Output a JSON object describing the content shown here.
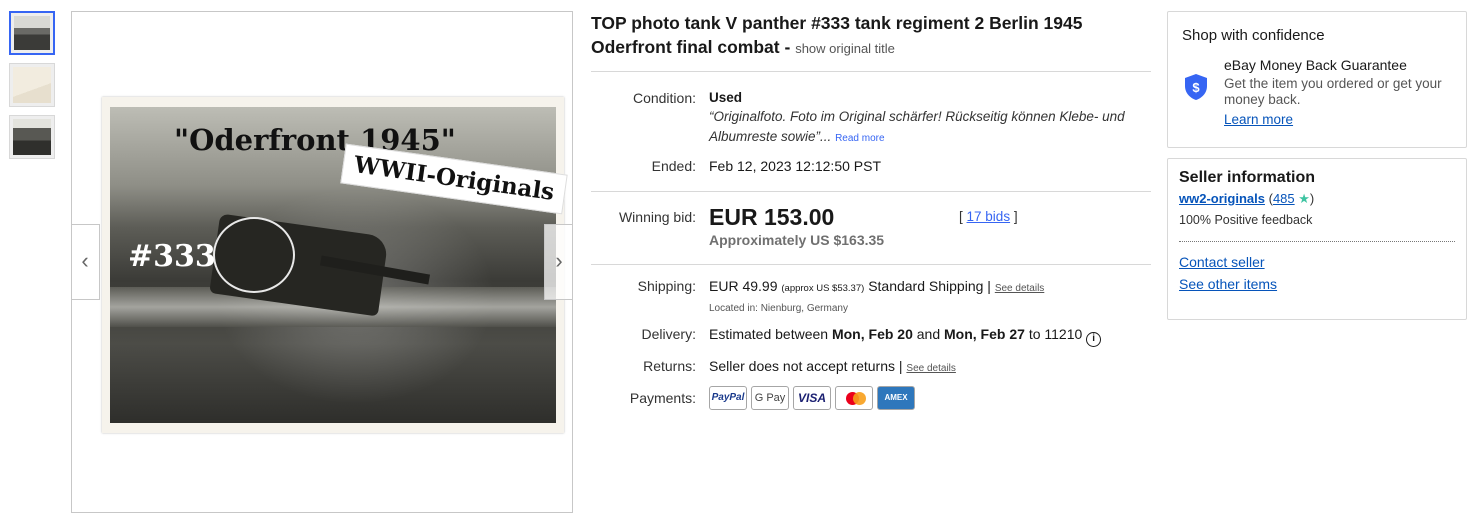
{
  "thumbnails": [
    "thumb-1",
    "thumb-2",
    "thumb-3"
  ],
  "image": {
    "caption_top": "\"Oderfront 1945\"",
    "caption_number": "#333",
    "stamp": "WWII-Originals",
    "arrow_left": "‹",
    "arrow_right": "›"
  },
  "listing": {
    "title": "TOP photo tank V panther #333 tank regiment 2 Berlin 1945 Oderfront final combat - ",
    "show_original": "show original title",
    "condition_label": "Condition:",
    "condition_value": "Used",
    "condition_quote": "“Originalfoto. Foto im Original schärfer! Rückseitig können Klebe- und Albumreste sowie”...",
    "read_more": "Read more",
    "ended_label": "Ended:",
    "ended_value": "Feb 12, 2023 12:12:50 PST",
    "winning_bid_label": "Winning bid:",
    "winning_bid_value": "EUR 153.00",
    "bids_link": "17 bids",
    "bids_open": "[",
    "bids_close": "]",
    "approx_value": "Approximately US $163.35",
    "shipping_label": "Shipping:",
    "shipping_price": "EUR 49.99",
    "shipping_approx": "(approx US $53.37)",
    "shipping_service": "Standard Shipping |",
    "see_details": "See details",
    "located_in": "Located in: Nienburg, Germany",
    "delivery_label": "Delivery:",
    "delivery_prefix": "Estimated between",
    "delivery_start": "Mon, Feb 20",
    "delivery_and": "and",
    "delivery_end": "Mon, Feb 27",
    "delivery_to": "to 11210",
    "returns_label": "Returns:",
    "returns_value": "Seller does not accept returns |",
    "returns_link": "See details",
    "payments_label": "Payments:",
    "payments": {
      "paypal": "PayPal",
      "gpay": "G Pay",
      "visa": "VISA",
      "amex": "AMEX"
    }
  },
  "confidence": {
    "heading": "Shop with confidence",
    "guarantee_title": "eBay Money Back Guarantee",
    "guarantee_desc": "Get the item you ordered or get your money back.",
    "learn_more": "Learn more",
    "icon": "shield-dollar-icon"
  },
  "seller": {
    "heading": "Seller information",
    "name": "ww2-originals",
    "feedback_count": "485",
    "feedback_text": "100% Positive feedback",
    "contact": "Contact seller",
    "other_items": "See other items"
  },
  "colors": {
    "link": "#3665f3",
    "seller_link": "#0654ba",
    "star": "#3ec4a2",
    "shield": "#3665f3"
  }
}
